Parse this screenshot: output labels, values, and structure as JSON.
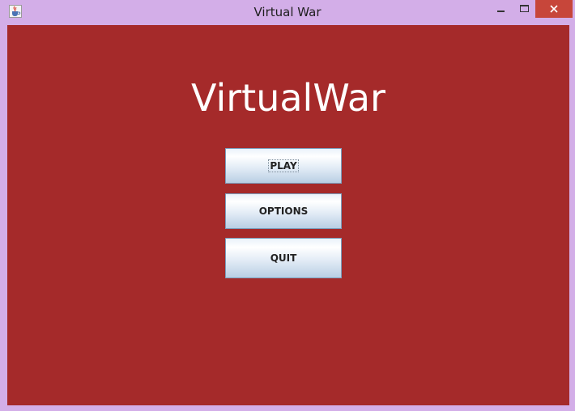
{
  "window": {
    "title": "Virtual War",
    "icon": "java-cup-icon",
    "controls": {
      "minimize": "minimize-icon",
      "maximize": "maximize-icon",
      "close": "close-icon"
    }
  },
  "main": {
    "title": "VirtualWar",
    "background_color": "#a52a2a",
    "menu": {
      "play_label": "PLAY",
      "options_label": "OPTIONS",
      "quit_label": "QUIT"
    }
  },
  "colors": {
    "frame": "#d3aee8",
    "close_button": "#c7463a"
  }
}
